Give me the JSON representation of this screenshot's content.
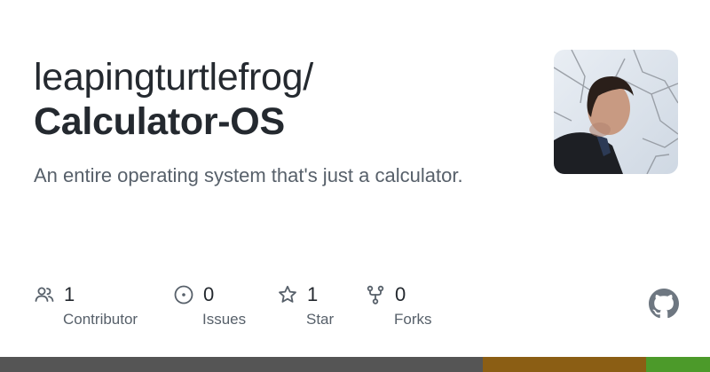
{
  "repo": {
    "owner": "leapingturtlefrog/",
    "name": "Calculator-OS",
    "description": "An entire operating system that's just a calculator."
  },
  "stats": {
    "contributors": {
      "value": "1",
      "label": "Contributor",
      "icon": "people-icon"
    },
    "issues": {
      "value": "0",
      "label": "Issues",
      "icon": "issue-icon"
    },
    "stars": {
      "value": "1",
      "label": "Star",
      "icon": "star-icon"
    },
    "forks": {
      "value": "0",
      "label": "Forks",
      "icon": "fork-icon"
    }
  },
  "brand_icon": "github-icon",
  "language_bar": [
    {
      "color": "#555555",
      "fraction": 0.68
    },
    {
      "color": "#8b5e14",
      "fraction": 0.23
    },
    {
      "color": "#4c9a2a",
      "fraction": 0.09
    }
  ]
}
